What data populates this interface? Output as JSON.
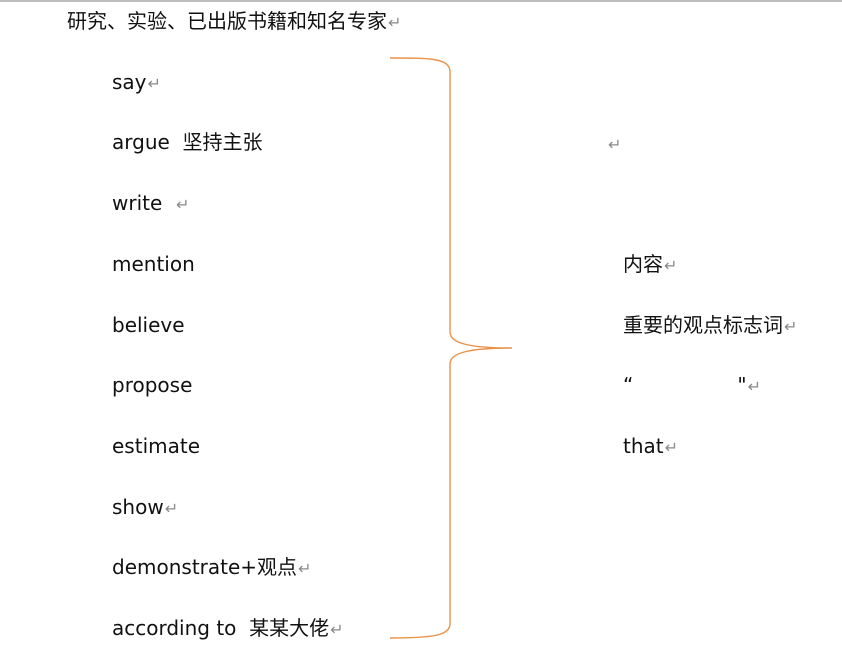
{
  "heading": "研究、实验、已出版书籍和知名专家",
  "paragraph_mark": "↵",
  "verbs": [
    {
      "text": "say",
      "mark": true
    },
    {
      "text": "argue  坚持主张",
      "mark": false
    },
    {
      "text": "write  ",
      "mark": true
    },
    {
      "text": "mention",
      "mark": false
    },
    {
      "text": "believe",
      "mark": false
    },
    {
      "text": "propose",
      "mark": false
    },
    {
      "text": "estimate",
      "mark": false
    },
    {
      "text": "show",
      "mark": true
    },
    {
      "text": "demonstrate+观点",
      "mark": true
    },
    {
      "text": "according to  某某大佬",
      "mark": true
    }
  ],
  "right_column": {
    "content": "内容",
    "indicator": "重要的观点标志词",
    "quote_open": "“",
    "quote_close": "\"",
    "that": "that"
  },
  "colors": {
    "brace": "#e8924a",
    "text": "#111111",
    "paragraph_mark": "#8a8a8a",
    "top_rule": "#bdbdbd"
  }
}
